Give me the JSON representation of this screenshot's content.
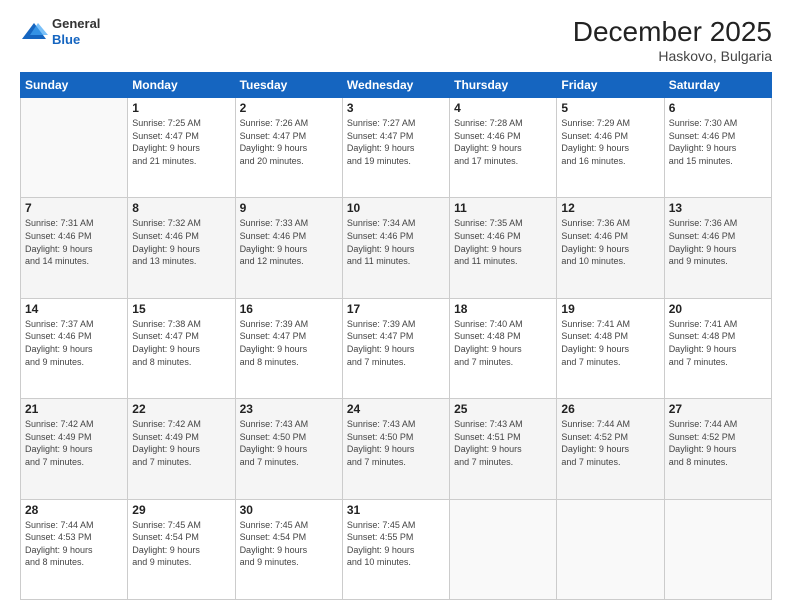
{
  "header": {
    "logo_line1": "General",
    "logo_line2": "Blue",
    "month": "December 2025",
    "location": "Haskovo, Bulgaria"
  },
  "days_of_week": [
    "Sunday",
    "Monday",
    "Tuesday",
    "Wednesday",
    "Thursday",
    "Friday",
    "Saturday"
  ],
  "weeks": [
    [
      {
        "day": "",
        "info": ""
      },
      {
        "day": "1",
        "info": "Sunrise: 7:25 AM\nSunset: 4:47 PM\nDaylight: 9 hours\nand 21 minutes."
      },
      {
        "day": "2",
        "info": "Sunrise: 7:26 AM\nSunset: 4:47 PM\nDaylight: 9 hours\nand 20 minutes."
      },
      {
        "day": "3",
        "info": "Sunrise: 7:27 AM\nSunset: 4:47 PM\nDaylight: 9 hours\nand 19 minutes."
      },
      {
        "day": "4",
        "info": "Sunrise: 7:28 AM\nSunset: 4:46 PM\nDaylight: 9 hours\nand 17 minutes."
      },
      {
        "day": "5",
        "info": "Sunrise: 7:29 AM\nSunset: 4:46 PM\nDaylight: 9 hours\nand 16 minutes."
      },
      {
        "day": "6",
        "info": "Sunrise: 7:30 AM\nSunset: 4:46 PM\nDaylight: 9 hours\nand 15 minutes."
      }
    ],
    [
      {
        "day": "7",
        "info": "Sunrise: 7:31 AM\nSunset: 4:46 PM\nDaylight: 9 hours\nand 14 minutes."
      },
      {
        "day": "8",
        "info": "Sunrise: 7:32 AM\nSunset: 4:46 PM\nDaylight: 9 hours\nand 13 minutes."
      },
      {
        "day": "9",
        "info": "Sunrise: 7:33 AM\nSunset: 4:46 PM\nDaylight: 9 hours\nand 12 minutes."
      },
      {
        "day": "10",
        "info": "Sunrise: 7:34 AM\nSunset: 4:46 PM\nDaylight: 9 hours\nand 11 minutes."
      },
      {
        "day": "11",
        "info": "Sunrise: 7:35 AM\nSunset: 4:46 PM\nDaylight: 9 hours\nand 11 minutes."
      },
      {
        "day": "12",
        "info": "Sunrise: 7:36 AM\nSunset: 4:46 PM\nDaylight: 9 hours\nand 10 minutes."
      },
      {
        "day": "13",
        "info": "Sunrise: 7:36 AM\nSunset: 4:46 PM\nDaylight: 9 hours\nand 9 minutes."
      }
    ],
    [
      {
        "day": "14",
        "info": "Sunrise: 7:37 AM\nSunset: 4:46 PM\nDaylight: 9 hours\nand 9 minutes."
      },
      {
        "day": "15",
        "info": "Sunrise: 7:38 AM\nSunset: 4:47 PM\nDaylight: 9 hours\nand 8 minutes."
      },
      {
        "day": "16",
        "info": "Sunrise: 7:39 AM\nSunset: 4:47 PM\nDaylight: 9 hours\nand 8 minutes."
      },
      {
        "day": "17",
        "info": "Sunrise: 7:39 AM\nSunset: 4:47 PM\nDaylight: 9 hours\nand 7 minutes."
      },
      {
        "day": "18",
        "info": "Sunrise: 7:40 AM\nSunset: 4:48 PM\nDaylight: 9 hours\nand 7 minutes."
      },
      {
        "day": "19",
        "info": "Sunrise: 7:41 AM\nSunset: 4:48 PM\nDaylight: 9 hours\nand 7 minutes."
      },
      {
        "day": "20",
        "info": "Sunrise: 7:41 AM\nSunset: 4:48 PM\nDaylight: 9 hours\nand 7 minutes."
      }
    ],
    [
      {
        "day": "21",
        "info": "Sunrise: 7:42 AM\nSunset: 4:49 PM\nDaylight: 9 hours\nand 7 minutes."
      },
      {
        "day": "22",
        "info": "Sunrise: 7:42 AM\nSunset: 4:49 PM\nDaylight: 9 hours\nand 7 minutes."
      },
      {
        "day": "23",
        "info": "Sunrise: 7:43 AM\nSunset: 4:50 PM\nDaylight: 9 hours\nand 7 minutes."
      },
      {
        "day": "24",
        "info": "Sunrise: 7:43 AM\nSunset: 4:50 PM\nDaylight: 9 hours\nand 7 minutes."
      },
      {
        "day": "25",
        "info": "Sunrise: 7:43 AM\nSunset: 4:51 PM\nDaylight: 9 hours\nand 7 minutes."
      },
      {
        "day": "26",
        "info": "Sunrise: 7:44 AM\nSunset: 4:52 PM\nDaylight: 9 hours\nand 7 minutes."
      },
      {
        "day": "27",
        "info": "Sunrise: 7:44 AM\nSunset: 4:52 PM\nDaylight: 9 hours\nand 8 minutes."
      }
    ],
    [
      {
        "day": "28",
        "info": "Sunrise: 7:44 AM\nSunset: 4:53 PM\nDaylight: 9 hours\nand 8 minutes."
      },
      {
        "day": "29",
        "info": "Sunrise: 7:45 AM\nSunset: 4:54 PM\nDaylight: 9 hours\nand 9 minutes."
      },
      {
        "day": "30",
        "info": "Sunrise: 7:45 AM\nSunset: 4:54 PM\nDaylight: 9 hours\nand 9 minutes."
      },
      {
        "day": "31",
        "info": "Sunrise: 7:45 AM\nSunset: 4:55 PM\nDaylight: 9 hours\nand 10 minutes."
      },
      {
        "day": "",
        "info": ""
      },
      {
        "day": "",
        "info": ""
      },
      {
        "day": "",
        "info": ""
      }
    ]
  ]
}
